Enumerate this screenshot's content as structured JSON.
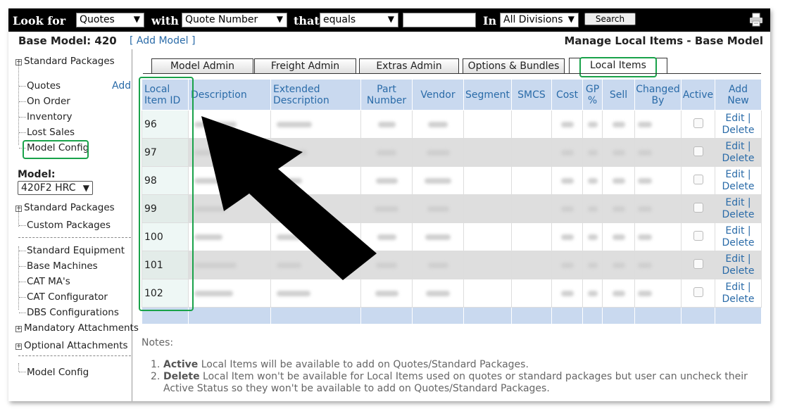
{
  "search_bar": {
    "look_for_label": "Look for",
    "look_for_value": "Quotes",
    "with_label": "with",
    "with_value": "Quote Number",
    "that_label": "that",
    "that_value": "equals",
    "search_text": "",
    "in_label": "In",
    "in_value": "All Divisions",
    "search_button": "Search",
    "printer_icon": "printer-icon"
  },
  "header": {
    "base_model": "Base Model: 420",
    "add_model": "[ Add Model ]",
    "page_title": "Manage Local Items - Base Model"
  },
  "sidebar": {
    "group1": "Standard Packages",
    "add_link": "Add",
    "items1": [
      "Quotes",
      "On Order",
      "Inventory",
      "Lost Sales",
      "Model Config"
    ],
    "model_label": "Model:",
    "model_value": "420F2 HRC",
    "group2": "Standard Packages",
    "custom_packages": "Custom Packages",
    "items2": [
      "Standard Equipment",
      "Base Machines",
      "CAT MA's",
      "CAT Configurator",
      "DBS Configurations"
    ],
    "mandatory_attachments": "Mandatory Attachments",
    "optional_attachments": "Optional Attachments",
    "model_config_bottom": "Model Config"
  },
  "tabs": [
    "Model Admin",
    "Freight Admin",
    "Extras Admin",
    "Options & Bundles",
    "Local Items"
  ],
  "active_tab": "Local Items",
  "table": {
    "headers": {
      "local_item_id": [
        "Local",
        "Item ID"
      ],
      "description": "Description",
      "extended_description": [
        "Extended",
        "Description"
      ],
      "part_number": [
        "Part",
        "Number"
      ],
      "vendor": "Vendor",
      "segment": "Segment",
      "smcs": "SMCS",
      "cost": "Cost",
      "gp": [
        "GP",
        "%"
      ],
      "sell": "Sell",
      "changed_by": [
        "Changed",
        "By"
      ],
      "active": "Active",
      "add_new": [
        "Add",
        "New"
      ]
    },
    "rows": [
      {
        "id": "96"
      },
      {
        "id": "97"
      },
      {
        "id": "98"
      },
      {
        "id": "99"
      },
      {
        "id": "100"
      },
      {
        "id": "101"
      },
      {
        "id": "102"
      }
    ],
    "edit_label": "Edit |",
    "delete_label": "Delete"
  },
  "notes": {
    "title": "Notes:",
    "n1_bold": "Active",
    "n1_rest": " Local Items will be available to add on Quotes/Standard Packages.",
    "n2_bold": "Delete",
    "n2_rest": " Local Item won't be available for Local Items used on quotes or standard packages but user can uncheck their Active Status so they won't be available to add on Quotes/Standard Packages."
  },
  "colors": {
    "highlight": "#19a24a",
    "header_bg": "#c9d9ef",
    "link": "#2a6ba8",
    "arrow": "#000000"
  }
}
